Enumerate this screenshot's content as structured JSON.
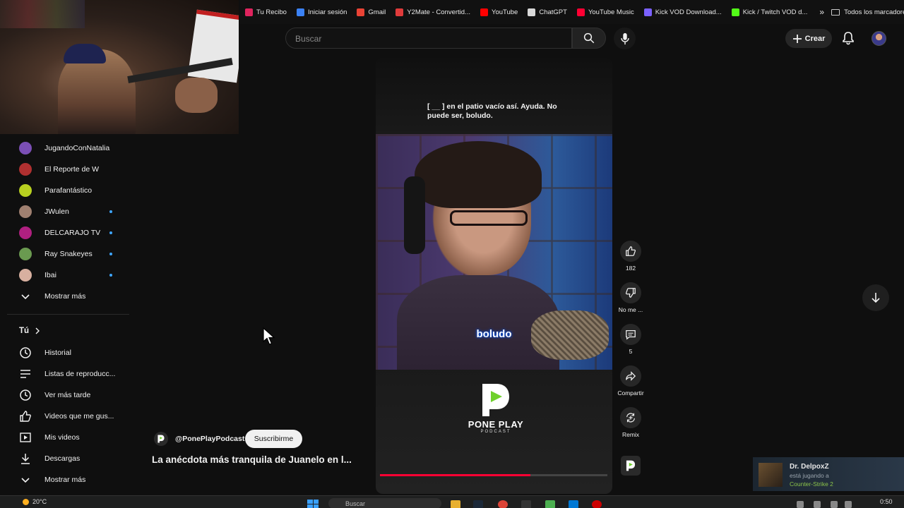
{
  "bookmarks": {
    "items": [
      {
        "label": "Tu Recibo",
        "color": "#e0245e"
      },
      {
        "label": "Iniciar sesión",
        "color": "#3b82f6"
      },
      {
        "label": "Gmail",
        "color": "#ea4335"
      },
      {
        "label": "Y2Mate - Convertid...",
        "color": "#e03b3b"
      },
      {
        "label": "YouTube",
        "color": "#ff0000"
      },
      {
        "label": "ChatGPT",
        "color": "#d9d9d9"
      },
      {
        "label": "YouTube Music",
        "color": "#ff0033"
      },
      {
        "label": "Kick VOD Download...",
        "color": "#7b61ff"
      },
      {
        "label": "Kick / Twitch VOD d...",
        "color": "#53fc18"
      }
    ],
    "more": "»",
    "all_bookmarks": "Todos los marcadores"
  },
  "header": {
    "search_placeholder": "Buscar",
    "create_label": "Crear"
  },
  "sidebar": {
    "subscriptions": [
      {
        "label": "JugandoConNatalia",
        "color": "#7b4fb5",
        "dot": false
      },
      {
        "label": "El Reporte de W",
        "color": "#b03030",
        "dot": false
      },
      {
        "label": "Parafantástico",
        "color": "#b8d020",
        "dot": false
      },
      {
        "label": "JWulen",
        "color": "#a08070",
        "dot": true
      },
      {
        "label": "DELCARAJO TV",
        "color": "#b02080",
        "dot": true
      },
      {
        "label": "Ray Snakeyes",
        "color": "#6a9a50",
        "dot": true
      },
      {
        "label": "Ibai",
        "color": "#d8b0a0",
        "dot": true
      }
    ],
    "show_more": "Mostrar más",
    "you_section": {
      "title": "Tú",
      "items": [
        {
          "label": "Historial",
          "icon": "history-icon"
        },
        {
          "label": "Listas de reproducc...",
          "icon": "playlist-icon"
        },
        {
          "label": "Ver más tarde",
          "icon": "clock-icon"
        },
        {
          "label": "Videos que me gus...",
          "icon": "like-icon"
        },
        {
          "label": "Mis videos",
          "icon": "my-videos-icon"
        },
        {
          "label": "Descargas",
          "icon": "download-icon"
        }
      ],
      "show_more": "Mostrar más"
    }
  },
  "short": {
    "caption": "[ __ ] en el patio vacío así. Ayuda. No puede ser, boludo.",
    "subtitle": "boludo",
    "brand_name": "PONE PLAY",
    "brand_sub": "PODCAST",
    "progress": 0.66,
    "accent_color": "#ff0033"
  },
  "actions": {
    "like_count": "182",
    "dislike_label": "No me ...",
    "comments_count": "5",
    "share_label": "Compartir",
    "remix_label": "Remix"
  },
  "channel": {
    "name": "@PonePlayPodcast",
    "subscribe_label": "Suscribirme",
    "video_title": "La anécdota más tranquila de Juanelo en l..."
  },
  "notification": {
    "user": "Dr. DelpoxZ",
    "status": "está jugando a",
    "game": "Counter-Strike 2"
  },
  "taskbar": {
    "weather": "20°C",
    "search_placeholder": "Buscar",
    "clock": "0:50"
  }
}
